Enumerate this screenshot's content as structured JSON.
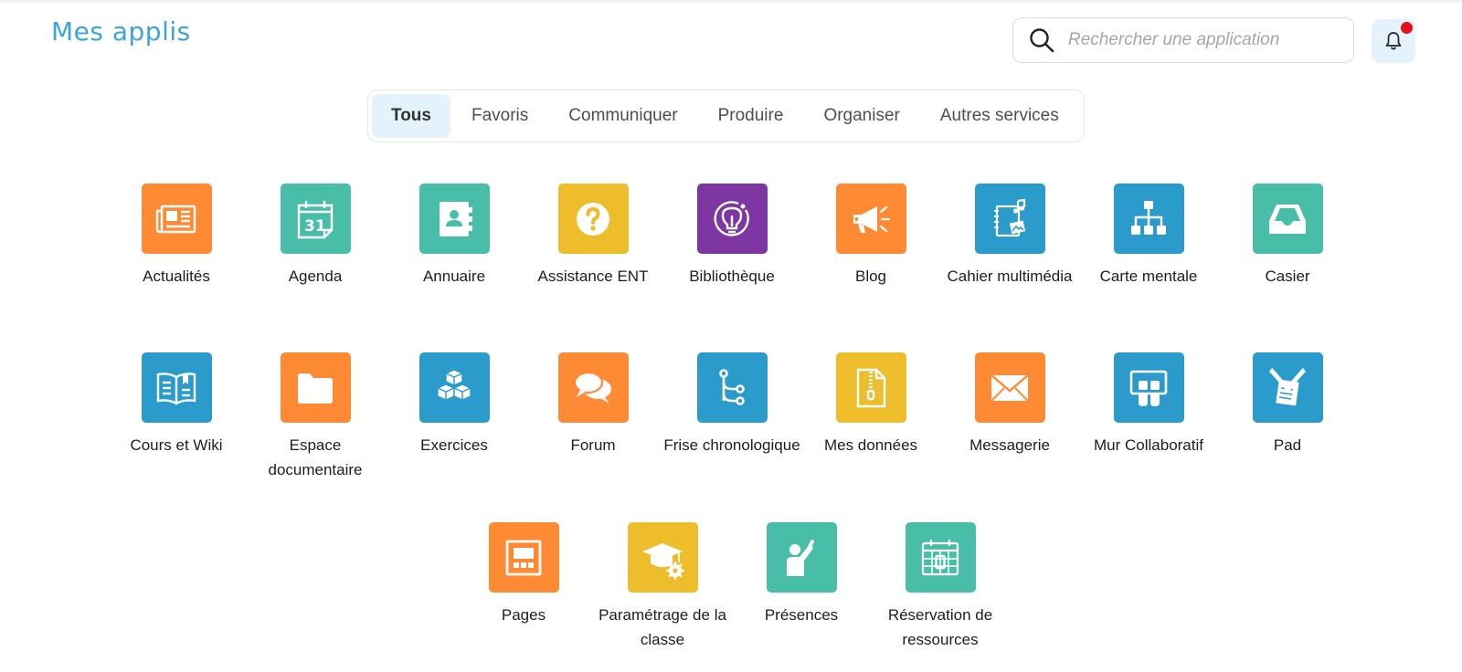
{
  "header": {
    "title": "Mes applis",
    "search_placeholder": "Rechercher une application",
    "search_icon": "search-icon",
    "notification_icon": "bell-icon"
  },
  "tabs": [
    {
      "label": "Tous",
      "active": true
    },
    {
      "label": "Favoris",
      "active": false
    },
    {
      "label": "Communiquer",
      "active": false
    },
    {
      "label": "Produire",
      "active": false
    },
    {
      "label": "Organiser",
      "active": false
    },
    {
      "label": "Autres services",
      "active": false
    }
  ],
  "colors": {
    "orange": "#fe8b34",
    "teal": "#48bea9",
    "yellow": "#edbd2c",
    "purple": "#7e36a2",
    "blue": "#2a9bcb",
    "title": "#3aa6d1",
    "notification_dot": "#e4101a"
  },
  "apps": [
    {
      "label": "Actualités",
      "icon": "newspaper-icon",
      "color": "orange"
    },
    {
      "label": "Agenda",
      "icon": "calendar-icon",
      "color": "teal"
    },
    {
      "label": "Annuaire",
      "icon": "contact-book-icon",
      "color": "teal"
    },
    {
      "label": "Assistance ENT",
      "icon": "help-icon",
      "color": "yellow"
    },
    {
      "label": "Bibliothèque",
      "icon": "lightbulb-icon",
      "color": "purple"
    },
    {
      "label": "Blog",
      "icon": "megaphone-icon",
      "color": "orange"
    },
    {
      "label": "Cahier multimédia",
      "icon": "multimedia-notebook-icon",
      "color": "blue"
    },
    {
      "label": "Carte mentale",
      "icon": "mind-map-icon",
      "color": "blue"
    },
    {
      "label": "Casier",
      "icon": "inbox-tray-icon",
      "color": "teal"
    },
    {
      "label": "Cours et Wiki",
      "icon": "open-book-icon",
      "color": "blue"
    },
    {
      "label": "Espace documentaire",
      "icon": "folder-icon",
      "color": "orange"
    },
    {
      "label": "Exercices",
      "icon": "cubes-icon",
      "color": "blue"
    },
    {
      "label": "Forum",
      "icon": "chat-bubbles-icon",
      "color": "orange"
    },
    {
      "label": "Frise chronologique",
      "icon": "timeline-branch-icon",
      "color": "blue"
    },
    {
      "label": "Mes données",
      "icon": "zip-file-icon",
      "color": "yellow"
    },
    {
      "label": "Messagerie",
      "icon": "envelope-icon",
      "color": "orange"
    },
    {
      "label": "Mur Collaboratif",
      "icon": "sticky-notes-board-icon",
      "color": "blue"
    },
    {
      "label": "Pad",
      "icon": "pad-pencils-icon",
      "color": "blue"
    },
    {
      "label": "Pages",
      "icon": "page-layout-icon",
      "color": "orange"
    },
    {
      "label": "Paramétrage de la classe",
      "icon": "graduation-cap-gear-icon",
      "color": "yellow"
    },
    {
      "label": "Présences",
      "icon": "raised-hand-icon",
      "color": "teal"
    },
    {
      "label": "Réservation de ressources",
      "icon": "booking-calendar-icon",
      "color": "teal"
    }
  ]
}
